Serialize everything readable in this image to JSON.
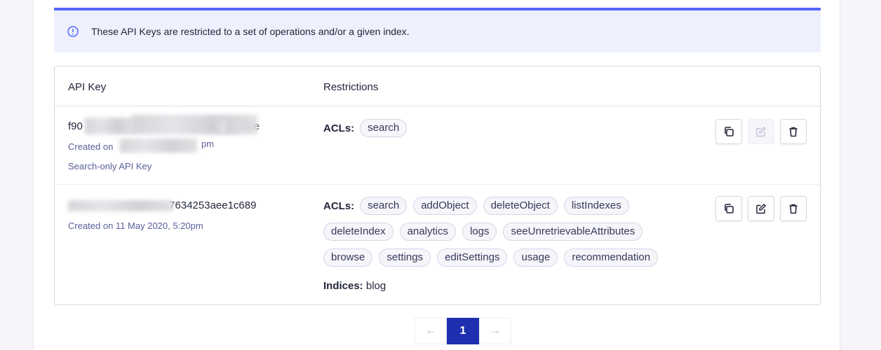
{
  "notice": {
    "text": "These API Keys are restricted to a set of operations and/or a given index."
  },
  "table": {
    "headers": {
      "key": "API Key",
      "restrictions": "Restrictions"
    },
    "rows": [
      {
        "key_prefix": "f90",
        "key_mid": "1a19c",
        "key_mid2": "0",
        "key_suffix": "20e",
        "created_prefix": "Created on",
        "created_suffix": "pm",
        "note": "Search-only API Key",
        "acl_label": "ACLs:",
        "acls": [
          "search"
        ]
      },
      {
        "key_suffix": ".7634253aee1c689",
        "created": "Created on 11 May 2020, 5:20pm",
        "acl_label": "ACLs:",
        "acls_line1": [
          "search",
          "addObject",
          "deleteObject",
          "listIndexes"
        ],
        "acls_line2": [
          "deleteIndex",
          "analytics",
          "logs",
          "seeUnretrievableAttributes"
        ],
        "acls_line3": [
          "browse",
          "settings",
          "editSettings",
          "usage",
          "recommendation"
        ],
        "indices_label": "Indices:",
        "indices_value": "blog"
      }
    ]
  },
  "pagination": {
    "prev": "←",
    "current": "1",
    "next": "→"
  },
  "colors": {
    "accent": "#5468ff",
    "pager_active": "#1e2fb0",
    "notice_bg": "#eef0fd"
  }
}
